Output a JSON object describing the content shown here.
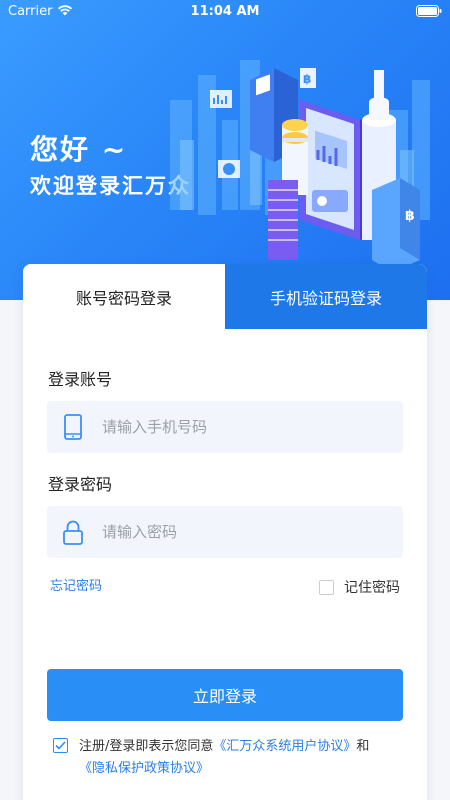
{
  "status_bar": {
    "carrier": "Carrier",
    "time": "11:04 AM"
  },
  "hero": {
    "greeting": "您好 ~",
    "welcome": "欢迎登录汇万众"
  },
  "tabs": {
    "account_password": "账号密码登录",
    "phone_code": "手机验证码登录",
    "active": "phone_code"
  },
  "form": {
    "account_label": "登录账号",
    "account_placeholder": "请输入手机号码",
    "account_value": "",
    "password_label": "登录密码",
    "password_placeholder": "请输入密码",
    "password_value": "",
    "forgot_password": "忘记密码",
    "remember_password": "记住密码",
    "remember_checked": false,
    "login_button": "立即登录"
  },
  "agreement": {
    "checked": true,
    "prefix": "注册/登录即表示您同意",
    "user_agreement": "《汇万众系统用户协议》",
    "and": "和",
    "privacy_policy": "《隐私保护政策协议》"
  },
  "colors": {
    "primary": "#2a8ef7",
    "active_tab": "#1e78e8",
    "link": "#2a7ee8",
    "input_bg": "#f2f6fc"
  }
}
